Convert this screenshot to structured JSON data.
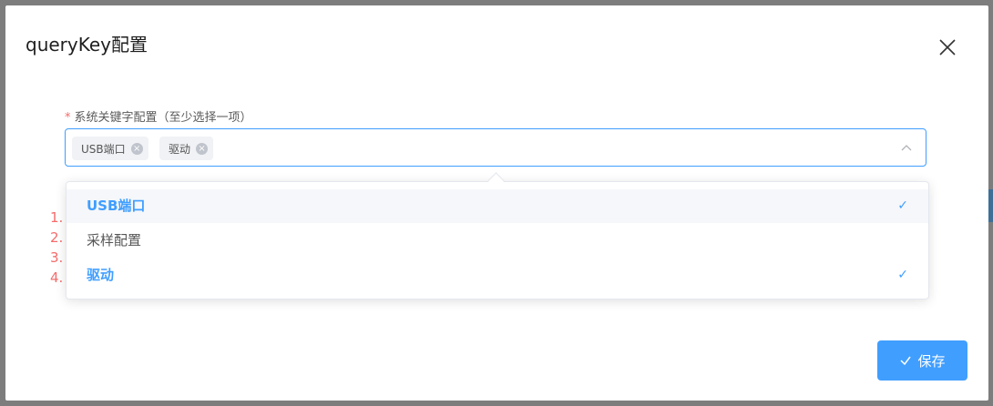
{
  "dialog": {
    "title": "queryKey配置",
    "close_icon": "close-icon"
  },
  "field": {
    "required_mark": "*",
    "label": "系统关键字配置（至少选择一项）",
    "tags": [
      {
        "label": "USB端口"
      },
      {
        "label": "驱动"
      }
    ],
    "tag_remove_icon": "circle-x-icon",
    "arrow_icon": "chevron-up-icon"
  },
  "dropdown": {
    "options": [
      {
        "label": "USB端口",
        "selected": true
      },
      {
        "label": "采样配置",
        "selected": false
      },
      {
        "label": "驱动",
        "selected": true
      }
    ],
    "check_mark": "✓"
  },
  "background_list": [
    "1.",
    "2.",
    "3.",
    "4."
  ],
  "footer": {
    "save_label": "保存",
    "save_icon": "check-icon"
  },
  "colors": {
    "primary": "#409eff",
    "danger": "#f56c6c",
    "tag_bg": "#f0f2f5"
  }
}
